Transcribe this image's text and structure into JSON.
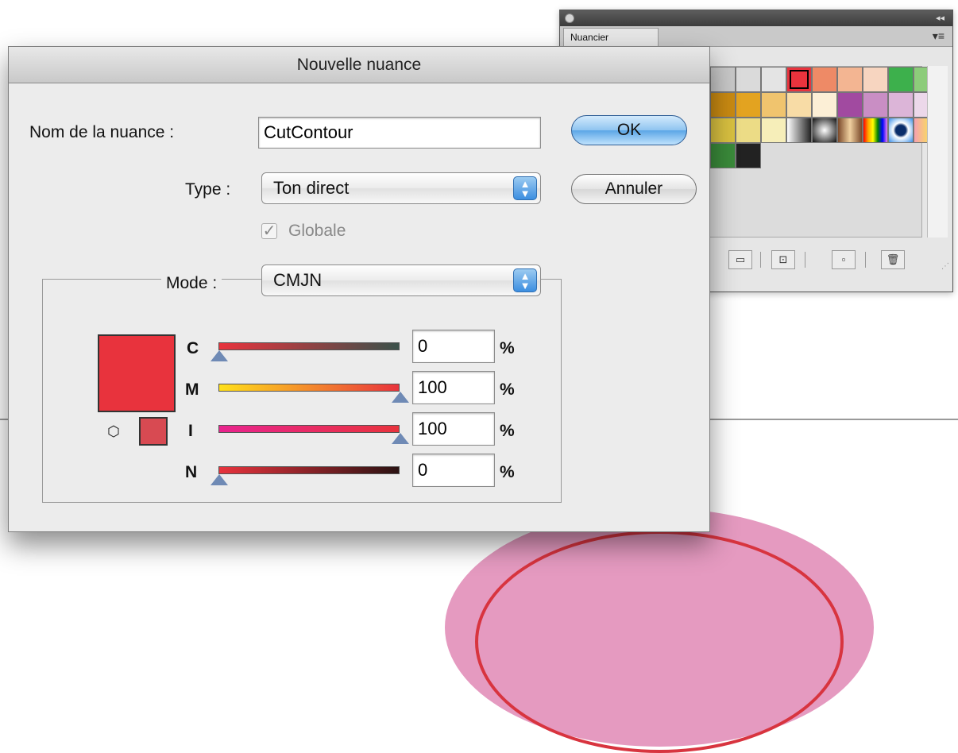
{
  "dialog": {
    "title": "Nouvelle nuance",
    "name_label": "Nom de la nuance :",
    "name_value": "CutContour",
    "ok_label": "OK",
    "cancel_label": "Annuler",
    "type_label": "Type :",
    "type_value": "Ton direct",
    "global_label": "Globale",
    "global_checked": true,
    "mode_label": "Mode :",
    "mode_value": "CMJN",
    "sliders": [
      {
        "label": "C",
        "value": "0",
        "unit": "%"
      },
      {
        "label": "M",
        "value": "100",
        "unit": "%"
      },
      {
        "label": "I",
        "value": "100",
        "unit": "%"
      },
      {
        "label": "N",
        "value": "0",
        "unit": "%"
      }
    ],
    "swatch_color": "#e8333d",
    "web_swatch_color": "#d84a52"
  },
  "panel": {
    "tab_label": "Nuancier",
    "menu_icon": "panel-menu-icon",
    "collapse_icon": "double-arrow-icon"
  },
  "canvas": {
    "pink_color": "#e59ac0",
    "ring_color": "#d8343f"
  }
}
